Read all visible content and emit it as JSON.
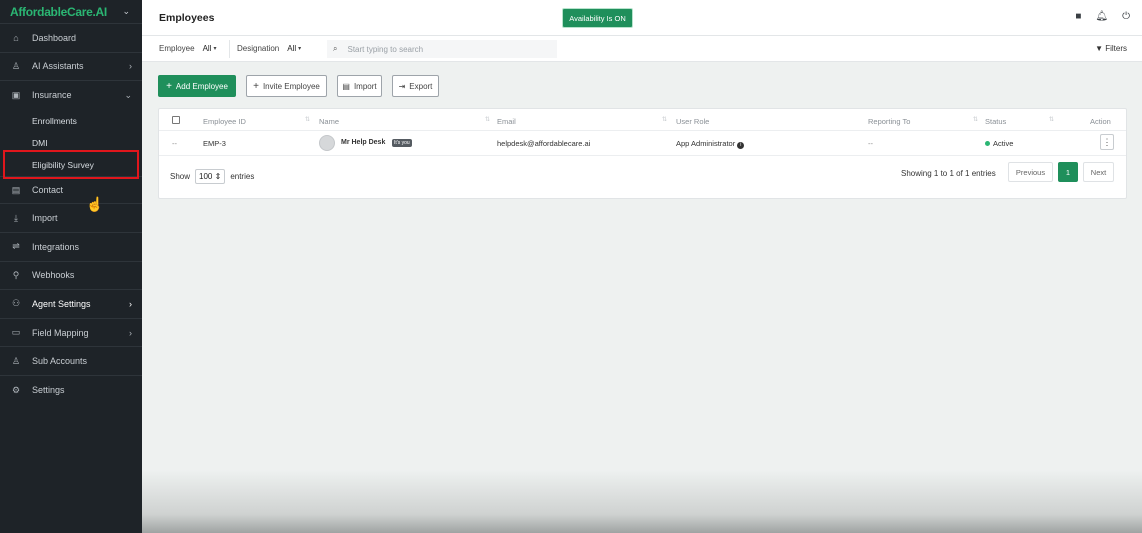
{
  "sidebar": {
    "brand": "AffordableCare.AI",
    "items": [
      {
        "label": "Dashboard",
        "icon": "home-icon"
      },
      {
        "label": "AI Assistants",
        "icon": "user-icon",
        "has_arrow": true
      },
      {
        "label": "Insurance",
        "icon": "id-card-icon",
        "expanded": true
      },
      {
        "label": "Contact",
        "icon": "contact-icon"
      },
      {
        "label": "Import",
        "icon": "import-icon"
      },
      {
        "label": "Integrations",
        "icon": "plug-icon"
      },
      {
        "label": "Webhooks",
        "icon": "webhook-icon"
      },
      {
        "label": "Agent Settings",
        "icon": "agents-icon",
        "has_arrow": true
      },
      {
        "label": "Field Mapping",
        "icon": "database-icon",
        "has_arrow": true
      },
      {
        "label": "Sub Accounts",
        "icon": "user-icon"
      },
      {
        "label": "Settings",
        "icon": "gear-icon"
      }
    ],
    "insurance_sub": [
      "Enrollments",
      "DMI",
      "Eligibility Survey"
    ]
  },
  "header": {
    "title": "Employees",
    "availability": "Availability Is ON"
  },
  "filters": {
    "employee_label": "Employee",
    "employee_value": "All",
    "designation_label": "Designation",
    "designation_value": "All",
    "search_placeholder": "Start typing to search",
    "filters_label": "Filters"
  },
  "actions": {
    "add": "Add Employee",
    "invite": "Invite Employee",
    "import": "Import",
    "export": "Export"
  },
  "table": {
    "columns": [
      "Employee ID",
      "Name",
      "Email",
      "User Role",
      "Reporting To",
      "Status",
      "Action"
    ],
    "rows": [
      {
        "dash": "--",
        "employee_id": "EMP-3",
        "name": "Mr Help Desk",
        "tag": "It's you",
        "email": "helpdesk@affordablecare.ai",
        "role": "App Administrator",
        "reporting_to": "--",
        "status": "Active"
      }
    ],
    "show_label": "Show",
    "entries_value": "100",
    "entries_label": "entries",
    "showing_text": "Showing 1 to 1 of 1 entries",
    "prev": "Previous",
    "page": "1",
    "next": "Next"
  },
  "colors": {
    "accent": "#1f8f5b",
    "sidebar_bg": "#1e2328",
    "highlight": "#e0161c"
  }
}
